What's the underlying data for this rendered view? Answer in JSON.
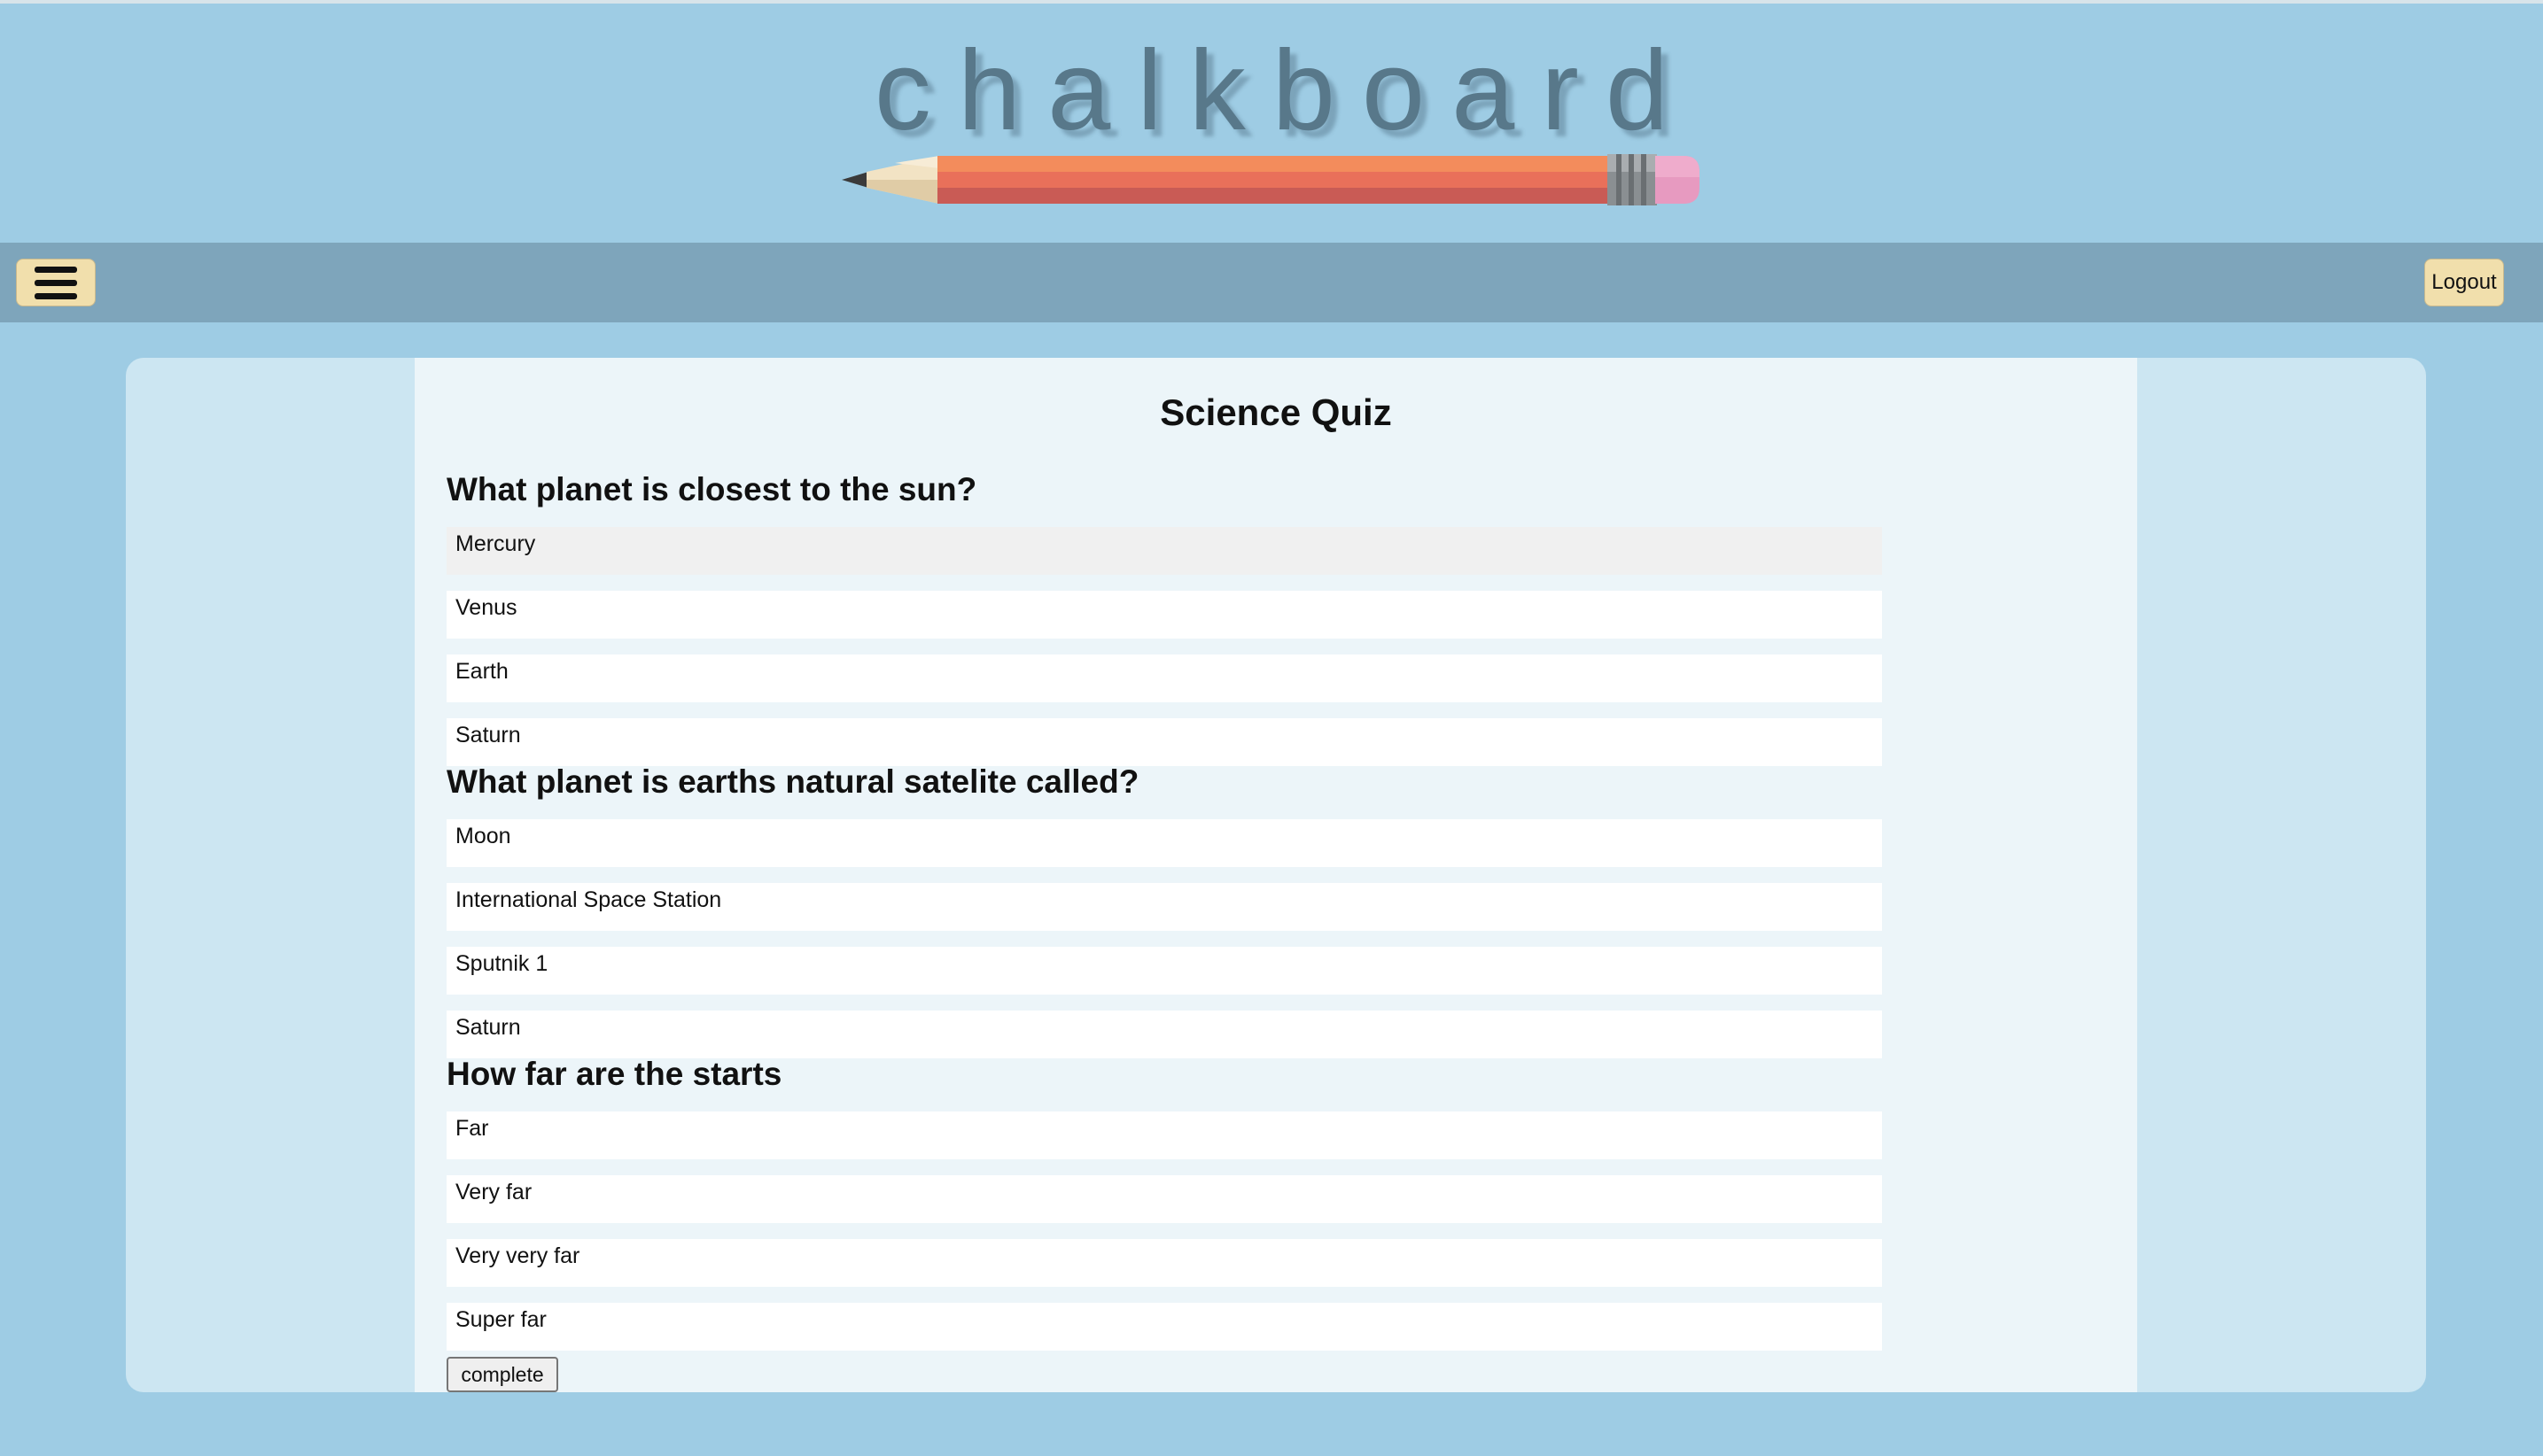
{
  "header": {
    "logo_text": "chalkboard"
  },
  "navbar": {
    "logout_label": "Logout"
  },
  "quiz": {
    "title": "Science Quiz",
    "questions": [
      {
        "text": "What planet is closest to the sun?",
        "options": [
          "Mercury",
          "Venus",
          "Earth",
          "Saturn"
        ]
      },
      {
        "text": "What planet is earths natural satelite called?",
        "options": [
          "Moon",
          "International Space Station",
          "Sputnik 1",
          "Saturn"
        ]
      },
      {
        "text": "How far are the starts",
        "options": [
          "Far",
          "Very far",
          "Very very far",
          "Super far"
        ]
      }
    ],
    "complete_label": "complete"
  },
  "icons": {
    "menu": "hamburger-menu-icon",
    "logo": "pencil-icon"
  },
  "colors": {
    "page_background": "#9ecce4",
    "navbar": "#7ea5bb",
    "button_background": "#f1dfac",
    "outer_panel": "#cce6f2",
    "inner_panel": "#ecf5f9",
    "option_background": "#ffffff",
    "option_hover": "#f0f0f0",
    "logo_text": "#58788a"
  }
}
